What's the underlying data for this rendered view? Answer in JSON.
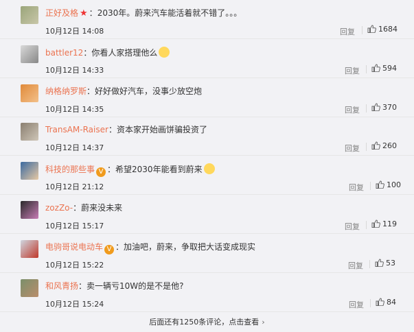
{
  "comments": [
    {
      "user": "正好及格",
      "badge": "star",
      "text": "2030年。蔚来汽车能活着就不错了。。。",
      "date": "10月12日 14:08",
      "reply": "回复",
      "likes": "1684"
    },
    {
      "user": "battler12",
      "badge": "",
      "text": "你看人家搭理他么",
      "emoji": true,
      "date": "10月12日 14:33",
      "reply": "回复",
      "likes": "594"
    },
    {
      "user": "纳格纳罗斯",
      "badge": "",
      "text": "好好做好汽车，没事少放空炮",
      "date": "10月12日 14:35",
      "reply": "回复",
      "likes": "370"
    },
    {
      "user": "TransAM-Raiser",
      "badge": "",
      "text": "资本家开始画饼骗投资了",
      "date": "10月12日 14:37",
      "reply": "回复",
      "likes": "260"
    },
    {
      "user": "科技的那些事",
      "badge": "v",
      "text": "希望2030年能看到蔚来",
      "emoji": true,
      "date": "10月12日 21:12",
      "reply": "回复",
      "likes": "100"
    },
    {
      "user": "zozZo-",
      "badge": "",
      "text": "蔚来没未来",
      "date": "10月12日 15:17",
      "reply": "回复",
      "likes": "119"
    },
    {
      "user": "电驹哥说电动车",
      "badge": "v",
      "text": "加油吧，蔚来，争取把大话变成现实",
      "date": "10月12日 15:22",
      "reply": "回复",
      "likes": "53"
    },
    {
      "user": "和风青扬",
      "badge": "",
      "text": "卖一辆亏10W的是不是他?",
      "date": "10月12日 15:24",
      "reply": "回复",
      "likes": "84"
    }
  ],
  "badge_v_label": "V",
  "footer": {
    "text": "后面还有1250条评论，点击查看",
    "chevron": "›"
  },
  "colors": {
    "username": "#eb7350",
    "badge": "#f09b1d",
    "background": "#f2f2f5"
  }
}
